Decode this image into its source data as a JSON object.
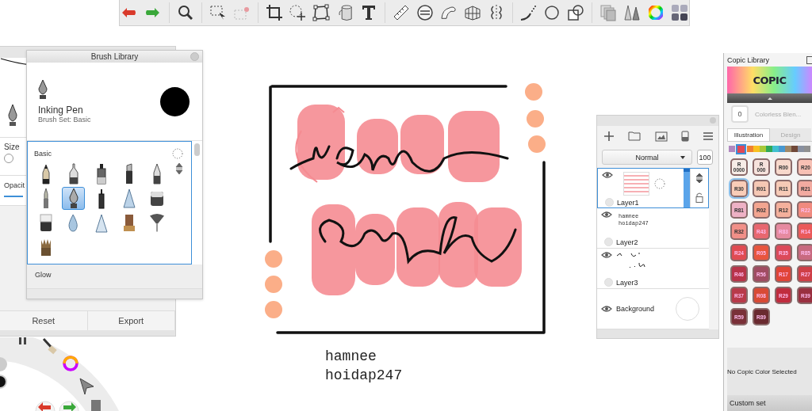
{
  "brush_properties": {
    "size": {
      "label": "Size",
      "level": 0
    },
    "opacity": {
      "label": "Opacit"
    },
    "buttons": [
      "Reset",
      "Export"
    ]
  },
  "brush_library": {
    "title": "Brush Library",
    "brush_name": "Inking Pen",
    "brush_set": "Brush Set: Basic",
    "sections": [
      {
        "name": "Basic",
        "brushes": [
          {
            "kind": "pencil",
            "selected": false
          },
          {
            "kind": "technical",
            "selected": false
          },
          {
            "kind": "marker",
            "selected": false
          },
          {
            "kind": "chisel",
            "selected": false
          },
          {
            "kind": "ballpoint",
            "selected": false
          },
          {
            "kind": "paintbrush",
            "selected": false
          },
          {
            "kind": "nib",
            "selected": true
          },
          {
            "kind": "fineliner",
            "selected": false
          },
          {
            "kind": "airbrush",
            "selected": false
          },
          {
            "kind": "block",
            "selected": false
          },
          {
            "kind": "eraser",
            "selected": false
          },
          {
            "kind": "drop",
            "selected": false
          },
          {
            "kind": "cone",
            "selected": false
          },
          {
            "kind": "stamp",
            "selected": false
          },
          {
            "kind": "fan",
            "selected": false
          },
          {
            "kind": "bristle",
            "selected": false
          }
        ]
      },
      {
        "name": "Glow"
      }
    ]
  },
  "canvas": {
    "text_lines": [
      "hamnee",
      "hoidap247"
    ]
  },
  "layers": {
    "blend_mode": "Normal",
    "opacity": "100",
    "items": [
      {
        "kind": "artwork",
        "name": "Layer1",
        "selected": true,
        "visible": true
      },
      {
        "kind": "text",
        "name": "Layer2",
        "selected": false,
        "visible": true,
        "preview_lines": [
          "hamnee",
          "hoidap247"
        ]
      },
      {
        "kind": "strokes",
        "name": "Layer3",
        "selected": false,
        "visible": true
      },
      {
        "kind": "background",
        "name": "Background",
        "selected": false,
        "visible": true
      }
    ]
  },
  "copic": {
    "title": "Copic Library",
    "logo": "COPIC",
    "colorless": {
      "code": "0",
      "name": "Colorless Blen..."
    },
    "tabs": [
      {
        "label": "Illustration",
        "selected": true
      },
      {
        "label": "Design",
        "selected": false
      }
    ],
    "families": [
      {
        "color": "#b088c0",
        "selected": false
      },
      {
        "color": "#e04858",
        "selected": true
      },
      {
        "color": "#f08030",
        "selected": false
      },
      {
        "color": "#f8c020",
        "selected": false
      },
      {
        "color": "#a8c838",
        "selected": false
      },
      {
        "color": "#30a858",
        "selected": false
      },
      {
        "color": "#40c0d0",
        "selected": false
      },
      {
        "color": "#4898d0",
        "selected": false
      },
      {
        "color": "#a08868",
        "selected": false
      },
      {
        "color": "#704838",
        "selected": false
      },
      {
        "color": "#8890a0",
        "selected": false
      },
      {
        "color": "#909090",
        "selected": false
      }
    ],
    "swatches": [
      {
        "code": "R 0000",
        "color": "#f7ece7",
        "selected": false
      },
      {
        "code": "R 000",
        "color": "#f6e2dc",
        "selected": false
      },
      {
        "code": "R00",
        "color": "#f7d8cb",
        "selected": false
      },
      {
        "code": "R20",
        "color": "#f7c0b4",
        "selected": false
      },
      {
        "code": "R30",
        "color": "#f9cdb8",
        "selected": true
      },
      {
        "code": "R01",
        "color": "#f6c8b4",
        "selected": false
      },
      {
        "code": "R11",
        "color": "#f6cab6",
        "selected": false
      },
      {
        "code": "R21",
        "color": "#f2aaa0",
        "selected": false
      },
      {
        "code": "R81",
        "color": "#eeb1c5",
        "selected": false
      },
      {
        "code": "R02",
        "color": "#f3a590",
        "selected": false
      },
      {
        "code": "R12",
        "color": "#f4b09c",
        "selected": false
      },
      {
        "code": "R22",
        "color": "#f08a7f",
        "selected": false
      },
      {
        "code": "R32",
        "color": "#f18f88",
        "selected": false
      },
      {
        "code": "R43",
        "color": "#e8676f",
        "selected": false
      },
      {
        "code": "R83",
        "color": "#e68aa0",
        "selected": false
      },
      {
        "code": "R14",
        "color": "#eb5a5a",
        "selected": false
      },
      {
        "code": "R24",
        "color": "#e04b52",
        "selected": false
      },
      {
        "code": "R05",
        "color": "#e8553e",
        "selected": false
      },
      {
        "code": "R35",
        "color": "#dc4a5a",
        "selected": false
      },
      {
        "code": "R85",
        "color": "#c86a80",
        "selected": false
      },
      {
        "code": "R46",
        "color": "#b8344a",
        "selected": false
      },
      {
        "code": "R56",
        "color": "#a04c62",
        "selected": false
      },
      {
        "code": "R17",
        "color": "#e04438",
        "selected": false
      },
      {
        "code": "R27",
        "color": "#cf3f47",
        "selected": false
      },
      {
        "code": "R37",
        "color": "#b83a4a",
        "selected": false
      },
      {
        "code": "R08",
        "color": "#d84a35",
        "selected": false
      },
      {
        "code": "R29",
        "color": "#c02c3e",
        "selected": false
      },
      {
        "code": "R39",
        "color": "#9a3040",
        "selected": false
      },
      {
        "code": "R59",
        "color": "#7a3038",
        "selected": false
      },
      {
        "code": "R89",
        "color": "#6a2a30",
        "selected": false
      }
    ],
    "status": "No Copic Color Selected",
    "custom_set": "Custom set"
  }
}
